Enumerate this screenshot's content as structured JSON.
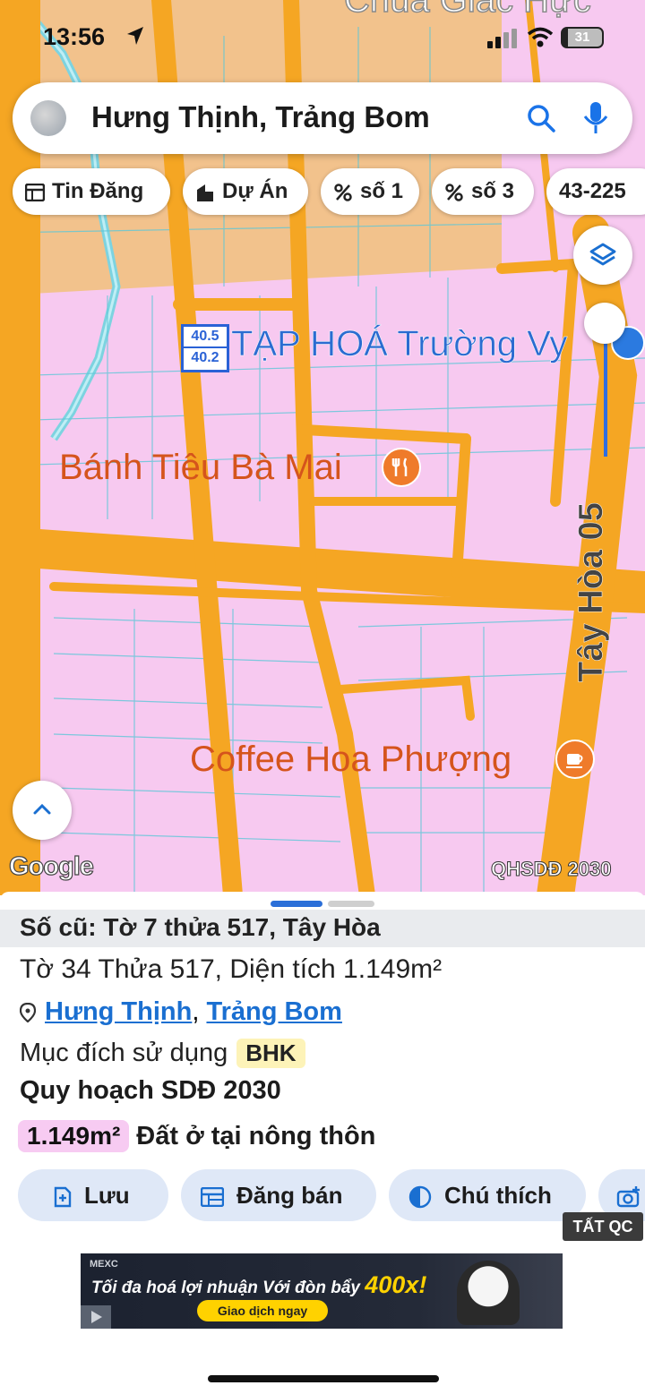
{
  "status_bar": {
    "time": "13:56",
    "battery": "31"
  },
  "search": {
    "query": "Hưng Thịnh, Trảng Bom"
  },
  "chips": [
    {
      "label": "Tin Đăng",
      "icon": "table-icon"
    },
    {
      "label": "Dự Án",
      "icon": "building-icon"
    },
    {
      "label": "số 1",
      "icon": "percent-icon"
    },
    {
      "label": "số 3",
      "icon": "percent-icon"
    },
    {
      "label": "43-225",
      "icon": ""
    }
  ],
  "map": {
    "top_label": "Chùa Giác Hực",
    "parcel_label_top": "40.5",
    "parcel_label_bottom": "40.2",
    "poi_1": "TẠP HOÁ Trường Vy",
    "poi_2": "Bánh Tiêu Bà Mai",
    "poi_3": "Coffee Hoa Phượng",
    "road_label": "Tây Hòa 05",
    "attribution": "Google",
    "layer_tag": "QHSDĐ 2030",
    "colors": {
      "residential": "#f7c9f0",
      "road": "#f5a623",
      "farmland": "#f2c28c"
    }
  },
  "sheet": {
    "old_number": "Số cũ: Tờ 7 thửa 517, Tây Hòa",
    "parcel_info": "Tờ 34 Thửa 517, Diện tích 1.149m²",
    "address_ward": "Hưng Thịnh",
    "address_sep": ",",
    "address_district": "Trảng Bom",
    "purpose_label": "Mục đích sử dụng",
    "purpose_code": "BHK",
    "plan_title": "Quy hoạch SDĐ 2030",
    "area_value": "1.149m²",
    "area_desc": "Đất ở tại nông thôn",
    "actions": {
      "save": "Lưu",
      "post_sale": "Đăng bán",
      "legend": "Chú thích"
    },
    "hide_ads": "TẤT QC"
  },
  "ad": {
    "brand": "MEXC",
    "headline": "Tối đa hoá lợi nhuận Với đòn bẩy",
    "highlight": "400x!",
    "cta": "Giao dịch ngay"
  }
}
